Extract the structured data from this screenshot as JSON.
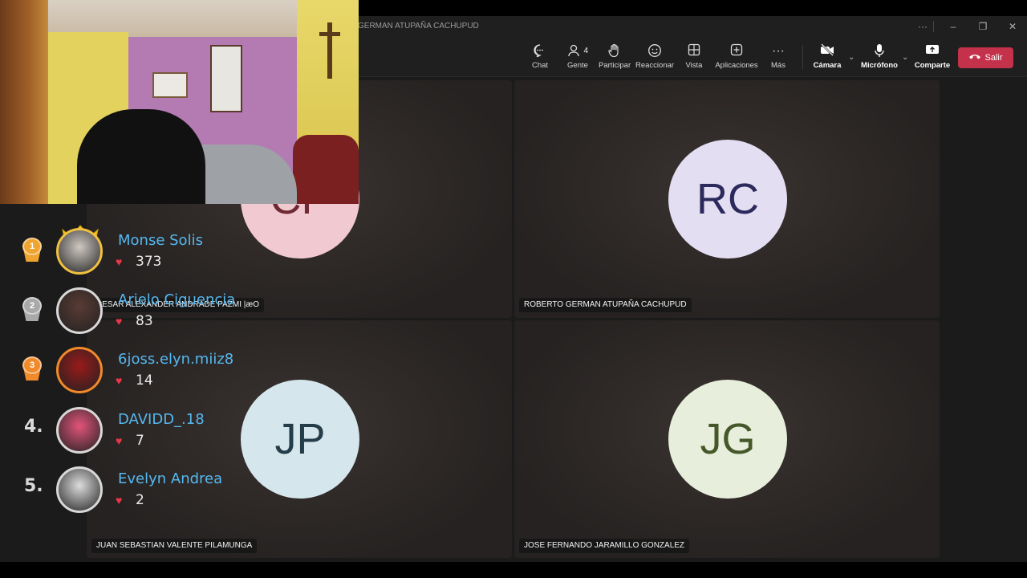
{
  "window": {
    "title": "GERMAN ATUPAÑA CACHUPUD",
    "controls": {
      "more": "···",
      "minimize": "–",
      "restore": "❐",
      "close": "✕"
    }
  },
  "toolbar": {
    "chat": "Chat",
    "people": "Gente",
    "people_count": "4",
    "raise_hand": "Participar",
    "react": "Reaccionar",
    "view": "Vista",
    "apps": "Aplicaciones",
    "more": "Más",
    "camera": "Cámara",
    "microphone": "Micrófono",
    "share": "Comparte",
    "leave": "Salir"
  },
  "participants": [
    {
      "initials": "CP",
      "name": "CESAR ALEXANDER ANDRADE PAZMI |æO",
      "avatar_bg": "#f0c9d1",
      "avatar_fg": "#6e2a34"
    },
    {
      "initials": "RC",
      "name": "ROBERTO GERMAN ATUPAÑA CACHUPUD",
      "avatar_bg": "#e4def2",
      "avatar_fg": "#2c2a5c"
    },
    {
      "initials": "JP",
      "name": "JUAN SEBASTIAN VALENTE PILAMUNGA",
      "avatar_bg": "#d6e6ed",
      "avatar_fg": "#253d48"
    },
    {
      "initials": "JG",
      "name": "JOSE FERNANDO JARAMILLO GONZALEZ",
      "avatar_bg": "#e8eedc",
      "avatar_fg": "#46582a"
    }
  ],
  "leaderboard": [
    {
      "rank": "1",
      "name": "Monse Solis",
      "score": "373",
      "medal_color": "#f0a430"
    },
    {
      "rank": "2",
      "name": "Arielo Ciguencia",
      "score": "83",
      "medal_color": "#a9a9a9"
    },
    {
      "rank": "3",
      "name": "6joss.elyn.miiz8",
      "score": "14",
      "medal_color": "#f08a2a"
    },
    {
      "rank": "4.",
      "name": "DAVIDD_.18",
      "score": "7"
    },
    {
      "rank": "5.",
      "name": "Evelyn Andrea",
      "score": "2"
    }
  ]
}
